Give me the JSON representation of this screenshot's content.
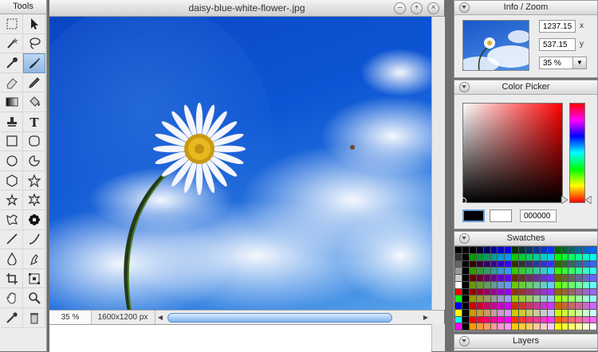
{
  "tools": {
    "title": "Tools",
    "items": [
      {
        "icon": "marquee-select-icon"
      },
      {
        "icon": "move-arrow-icon"
      },
      {
        "icon": "magic-wand-icon"
      },
      {
        "icon": "lasso-icon"
      },
      {
        "icon": "eyedropper-icon"
      },
      {
        "icon": "brush-icon",
        "active": true
      },
      {
        "icon": "eraser-icon"
      },
      {
        "icon": "pencil-icon"
      },
      {
        "icon": "gradient-icon"
      },
      {
        "icon": "paint-bucket-icon"
      },
      {
        "icon": "stamp-icon"
      },
      {
        "icon": "text-tool-icon"
      },
      {
        "icon": "rectangle-icon"
      },
      {
        "icon": "rounded-rectangle-icon"
      },
      {
        "icon": "ellipse-icon"
      },
      {
        "icon": "pie-shape-icon"
      },
      {
        "icon": "hexagon-icon"
      },
      {
        "icon": "star-icon"
      },
      {
        "icon": "star-five-icon"
      },
      {
        "icon": "burst-icon"
      },
      {
        "icon": "custom-shape-icon"
      },
      {
        "icon": "flower-shape-icon"
      },
      {
        "icon": "line-icon"
      },
      {
        "icon": "curve-icon"
      },
      {
        "icon": "blur-drop-icon"
      },
      {
        "icon": "smudge-icon"
      },
      {
        "icon": "crop-icon"
      },
      {
        "icon": "transform-icon"
      },
      {
        "icon": "hand-icon"
      },
      {
        "icon": "zoom-icon"
      },
      {
        "icon": "color-picker-icon"
      },
      {
        "icon": "trash-icon"
      }
    ]
  },
  "document": {
    "title": "daisy-blue-white-flower-.jpg",
    "zoom": "35 %",
    "dimensions": "1600x1200 px"
  },
  "info": {
    "title": "Info / Zoom",
    "x_value": "1237.15",
    "x_label": "x",
    "y_value": "537.15",
    "y_label": "y",
    "zoom": "35 %"
  },
  "picker": {
    "title": "Color Picker",
    "hex": "000000",
    "primary_color": "#000000",
    "secondary_color": "#ffffff"
  },
  "swatches": {
    "title": "Swatches"
  },
  "layers": {
    "title": "Layers"
  }
}
